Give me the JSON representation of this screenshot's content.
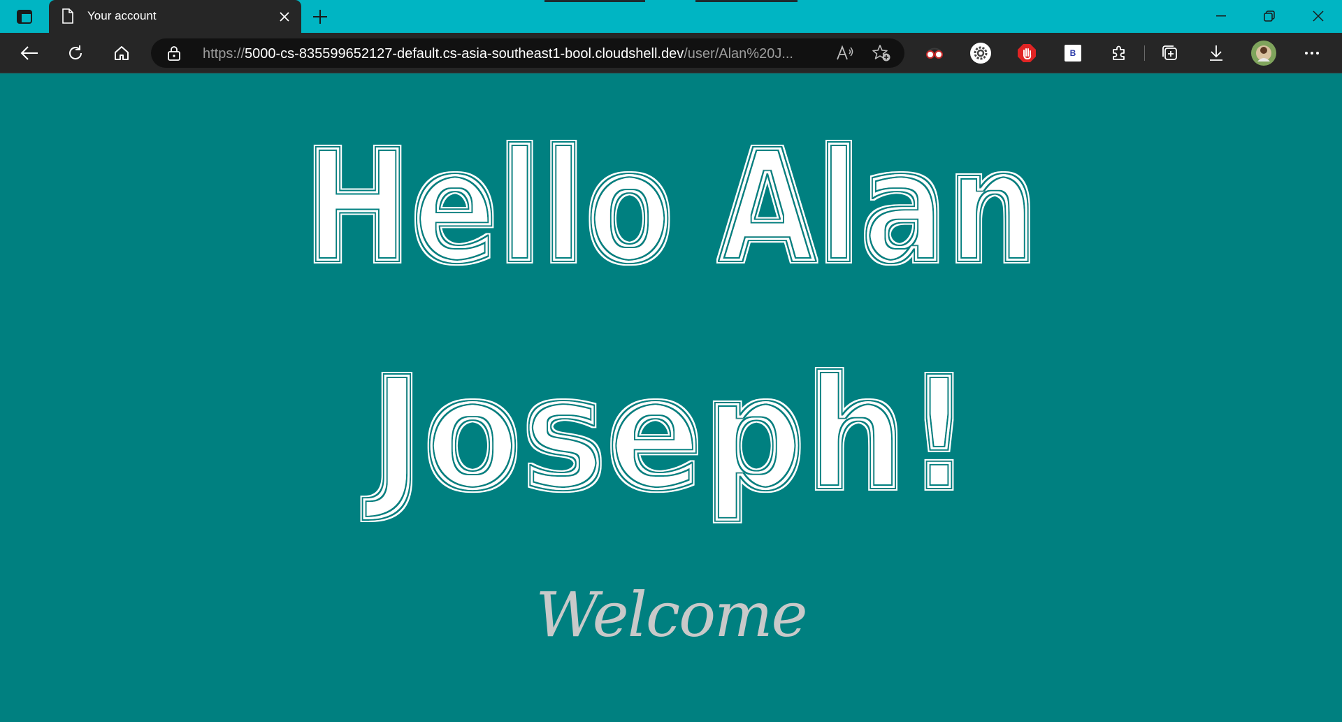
{
  "browser": {
    "tab": {
      "title": "Your account"
    },
    "address": {
      "scheme": "https://",
      "host": "5000-cs-835599652127-default.cs-asia-southeast1-bool.cloudshell.dev",
      "path": "/user/Alan%20J..."
    },
    "icons": {
      "tab_actions": "tab-actions-icon",
      "back": "back-arrow-icon",
      "refresh": "refresh-icon",
      "home": "home-icon",
      "lock": "lock-icon",
      "read_aloud": "read-aloud-icon",
      "add_favorite": "add-favorite-icon",
      "collections": "collections-icon",
      "downloads": "download-icon",
      "more": "more-icon"
    },
    "extensions": {
      "ext1_badge": "B"
    },
    "accent": "#00b5c3",
    "toolbar_color": "#262626"
  },
  "page": {
    "heading_line1": "Hello Alan",
    "heading_line2": "Joseph!",
    "subheading": "Welcome",
    "background": "#008080",
    "heading_color": "#ffffff",
    "subheading_color": "#c9c9c9"
  }
}
